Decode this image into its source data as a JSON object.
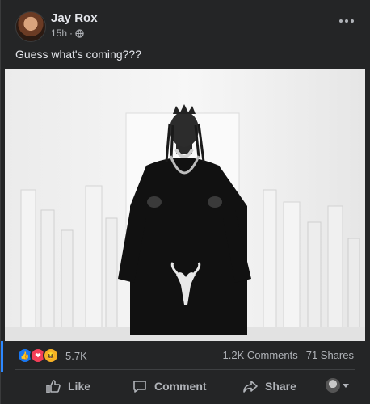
{
  "post": {
    "author": "Jay Rox",
    "time": "15h",
    "separator": "·",
    "caption": "Guess what's coming???"
  },
  "reactions": {
    "count": "5.7K",
    "types": [
      "like",
      "love",
      "haha"
    ]
  },
  "stats": {
    "comments": "1.2K Comments",
    "shares": "71 Shares"
  },
  "actions": {
    "like": "Like",
    "comment": "Comment",
    "share": "Share"
  },
  "colors": {
    "background": "#242526",
    "text": "#e4e6eb",
    "secondary_text": "#b0b3b8",
    "like_blue": "#1877f2",
    "love_red": "#f33e58",
    "haha_yellow": "#f7b125"
  },
  "icons": [
    "globe-icon",
    "more-options-icon",
    "like-icon",
    "comment-icon",
    "share-icon",
    "caret-down-icon"
  ]
}
